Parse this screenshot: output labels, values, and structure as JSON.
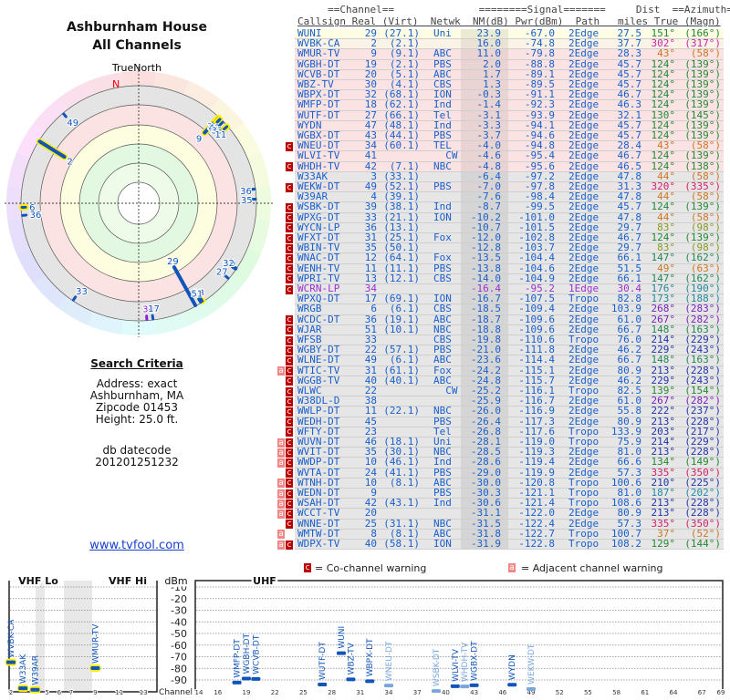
{
  "left": {
    "title1": "Ashburnham House",
    "title2": "All Channels",
    "north_label": "TrueNorth",
    "n_label": "N",
    "criteria_title": "Search Criteria",
    "address": "Address: exact",
    "city": "Ashburnham, MA",
    "zipcode": "Zipcode 01453",
    "height": "Height: 25.0 ft.",
    "db_label": "db datecode",
    "db_value": "201201251232",
    "link": "www.tvfool.com"
  },
  "table": {
    "header1": "     ==Channel==              ========Signal=======     Dist  ==Azimuth==",
    "header2": "Callsign Real (Virt)  Netwk  NM(dB) Pwr(dBm)  Path   miles True (Magn)",
    "tones": {
      "y1": "#fdfde4",
      "y2": "#fbf4e6",
      "p": "#fbe3e3",
      "p2": "#ece4e4",
      "g": "#e6e6e6"
    },
    "callsign_color": "#1a5fcc",
    "lp_color": "#9933cc",
    "rows": [
      [
        "WUNI",
        "29",
        "(27.1)",
        "Uni",
        "23.9",
        "-67.0",
        "2Edge",
        "27.5",
        "151°",
        "(166°)",
        "",
        "y1",
        "#228833"
      ],
      [
        "WVBK-CA",
        "2",
        "(2.1)",
        "",
        "16.0",
        "-74.8",
        "2Edge",
        "37.7",
        "302°",
        "(317°)",
        "",
        "y2",
        "#cc22aa"
      ],
      [
        "WMUR-TV",
        "9",
        "(9.1)",
        "ABC",
        "11.0",
        "-79.8",
        "2Edge",
        "28.3",
        "43°",
        "(58°)",
        "",
        "p",
        "#cc7722"
      ],
      [
        "WGBH-DT",
        "19",
        "(2.1)",
        "PBS",
        "2.0",
        "-88.8",
        "2Edge",
        "45.7",
        "124°",
        "(139°)",
        "",
        "p",
        "#228833"
      ],
      [
        "WCVB-DT",
        "20",
        "(5.1)",
        "ABC",
        "1.7",
        "-89.1",
        "2Edge",
        "45.7",
        "124°",
        "(139°)",
        "",
        "p",
        "#228833"
      ],
      [
        "WBZ-TV",
        "30",
        "(4.1)",
        "CBS",
        "1.3",
        "-89.5",
        "2Edge",
        "45.7",
        "124°",
        "(139°)",
        "",
        "p",
        "#228833"
      ],
      [
        "WBPX-DT",
        "32",
        "(68.1)",
        "ION",
        "-0.3",
        "-91.1",
        "2Edge",
        "46.7",
        "124°",
        "(139°)",
        "",
        "p",
        "#228833"
      ],
      [
        "WMFP-DT",
        "18",
        "(62.1)",
        "Ind",
        "-1.4",
        "-92.3",
        "2Edge",
        "46.3",
        "124°",
        "(139°)",
        "",
        "p",
        "#228833"
      ],
      [
        "WUTF-DT",
        "27",
        "(66.1)",
        "Tel",
        "-3.1",
        "-93.9",
        "2Edge",
        "32.1",
        "130°",
        "(145°)",
        "",
        "p",
        "#228833"
      ],
      [
        "WYDN",
        "47",
        "(48.1)",
        "Ind",
        "-3.3",
        "-94.1",
        "2Edge",
        "45.7",
        "124°",
        "(139°)",
        "",
        "p",
        "#228833"
      ],
      [
        "WGBX-DT",
        "43",
        "(44.1)",
        "PBS",
        "-3.7",
        "-94.6",
        "2Edge",
        "45.7",
        "124°",
        "(139°)",
        "",
        "p",
        "#228833"
      ],
      [
        "WNEU-DT",
        "34",
        "(60.1)",
        "TEL",
        "-4.0",
        "-94.8",
        "2Edge",
        "28.4",
        "43°",
        "(58°)",
        "c",
        "p",
        "#cc7722"
      ],
      [
        "WLVI-TV",
        "41",
        "",
        "CW",
        "-4.6",
        "-95.4",
        "2Edge",
        "46.7",
        "124°",
        "(139°)",
        "",
        "p",
        "#228833"
      ],
      [
        "WHDH-TV",
        "42",
        "(7.1)",
        "NBC",
        "-4.8",
        "-95.6",
        "2Edge",
        "46.5",
        "124°",
        "(138°)",
        "c",
        "p",
        "#228833"
      ],
      [
        "W33AK",
        "3",
        "(33.1)",
        "",
        "-6.4",
        "-97.2",
        "2Edge",
        "47.8",
        "44°",
        "(58°)",
        "",
        "g",
        "#cc7722"
      ],
      [
        "WEKW-DT",
        "49",
        "(52.1)",
        "PBS",
        "-7.0",
        "-97.8",
        "2Edge",
        "31.3",
        "320°",
        "(335°)",
        "c",
        "p2",
        "#cc2266"
      ],
      [
        "W39AR",
        "4",
        "(39.1)",
        "",
        "-7.6",
        "-98.4",
        "2Edge",
        "47.8",
        "44°",
        "(58°)",
        "",
        "g",
        "#cc7722"
      ],
      [
        "WSBK-DT",
        "39",
        "(38.1)",
        "Ind",
        "-8.7",
        "-99.5",
        "2Edge",
        "45.7",
        "124°",
        "(139°)",
        "c",
        "g",
        "#228833"
      ],
      [
        "WPXG-DT",
        "33",
        "(21.1)",
        "ION",
        "-10.2",
        "-101.0",
        "2Edge",
        "47.8",
        "44°",
        "(58°)",
        "c",
        "g",
        "#cc7722"
      ],
      [
        "WYCN-LP",
        "36",
        "(13.1)",
        "",
        "-10.7",
        "-101.5",
        "2Edge",
        "29.7",
        "83°",
        "(98°)",
        "c",
        "g",
        "#889922"
      ],
      [
        "WFXT-DT",
        "31",
        "(25.1)",
        "Fox",
        "-12.0",
        "-102.8",
        "2Edge",
        "46.7",
        "124°",
        "(139°)",
        "c",
        "g",
        "#228833"
      ],
      [
        "WBIN-TV",
        "35",
        "(50.1)",
        "",
        "-12.8",
        "-103.7",
        "2Edge",
        "29.7",
        "83°",
        "(98°)",
        "c",
        "g",
        "#889922"
      ],
      [
        "WNAC-DT",
        "12",
        "(64.1)",
        "Fox",
        "-13.5",
        "-104.4",
        "2Edge",
        "66.1",
        "147°",
        "(162°)",
        "c",
        "g",
        "#228855"
      ],
      [
        "WENH-TV",
        "11",
        "(11.1)",
        "PBS",
        "-13.8",
        "-104.6",
        "2Edge",
        "51.5",
        "49°",
        "(63°)",
        "c",
        "g",
        "#cc7722"
      ],
      [
        "WPRI-TV",
        "13",
        "(12.1)",
        "CBS",
        "-14.0",
        "-104.9",
        "2Edge",
        "66.1",
        "147°",
        "(162°)",
        "c",
        "g",
        "#228855"
      ],
      [
        "WCRN-LP",
        "34",
        "",
        "",
        "-16.4",
        "-95.2",
        "1Edge",
        "30.4",
        "176°",
        "(190°)",
        "c",
        "g",
        "#228899"
      ],
      [
        "WPXQ-DT",
        "17",
        "(69.1)",
        "ION",
        "-16.7",
        "-107.5",
        "Tropo",
        "82.8",
        "173°",
        "(188°)",
        "",
        "g",
        "#228899"
      ],
      [
        "WRGB",
        "6",
        "(6.1)",
        "CBS",
        "-18.5",
        "-109.4",
        "2Edge",
        "103.9",
        "268°",
        "(283°)",
        "",
        "g",
        "#7722bb"
      ],
      [
        "WCDC-DT",
        "36",
        "(19.1)",
        "ABC",
        "-18.7",
        "-109.6",
        "2Edge",
        "61.0",
        "267°",
        "(282°)",
        "c",
        "g",
        "#7722bb"
      ],
      [
        "WJAR",
        "51",
        "(10.1)",
        "NBC",
        "-18.8",
        "-109.6",
        "2Edge",
        "66.7",
        "148°",
        "(163°)",
        "c",
        "g",
        "#228855"
      ],
      [
        "WFSB",
        "33",
        "",
        "CBS",
        "-19.8",
        "-110.6",
        "Tropo",
        "76.0",
        "214°",
        "(229°)",
        "c",
        "g",
        "#2233aa"
      ],
      [
        "WGBY-DT",
        "22",
        "(57.1)",
        "PBS",
        "-21.0",
        "-111.8",
        "2Edge",
        "46.2",
        "229°",
        "(243°)",
        "c",
        "g",
        "#2233aa"
      ],
      [
        "WLNE-DT",
        "49",
        "(6.1)",
        "ABC",
        "-23.6",
        "-114.4",
        "2Edge",
        "66.7",
        "148°",
        "(163°)",
        "c",
        "g",
        "#228855"
      ],
      [
        "WTIC-TV",
        "31",
        "(61.1)",
        "Fox",
        "-24.2",
        "-115.1",
        "2Edge",
        "80.9",
        "213°",
        "(228°)",
        "ac",
        "g",
        "#2233aa"
      ],
      [
        "WGGB-TV",
        "40",
        "(40.1)",
        "ABC",
        "-24.8",
        "-115.7",
        "2Edge",
        "46.2",
        "229°",
        "(243°)",
        "c",
        "g",
        "#2233aa"
      ],
      [
        "WLWC",
        "22",
        "",
        "CW",
        "-25.2",
        "-116.1",
        "Tropo",
        "82.5",
        "139°",
        "(154°)",
        "c",
        "g",
        "#228833"
      ],
      [
        "W38DL-D",
        "38",
        "",
        "",
        "-25.9",
        "-116.7",
        "2Edge",
        "61.0",
        "267°",
        "(282°)",
        "c",
        "g",
        "#7722bb"
      ],
      [
        "WWLP-DT",
        "11",
        "(22.1)",
        "NBC",
        "-26.0",
        "-116.9",
        "2Edge",
        "55.8",
        "222°",
        "(237°)",
        "c",
        "g",
        "#2233aa"
      ],
      [
        "WEDH-DT",
        "45",
        "",
        "PBS",
        "-26.4",
        "-117.3",
        "2Edge",
        "80.9",
        "213°",
        "(228°)",
        "c",
        "g",
        "#2233aa"
      ],
      [
        "WFTY-DT",
        "23",
        "",
        "Tel",
        "-26.8",
        "-117.6",
        "Tropo",
        "133.9",
        "203°",
        "(217°)",
        "c",
        "g",
        "#2233aa"
      ],
      [
        "WUVN-DT",
        "46",
        "(18.1)",
        "Uni",
        "-28.1",
        "-119.0",
        "Tropo",
        "75.9",
        "214°",
        "(229°)",
        "ac",
        "g",
        "#2233aa"
      ],
      [
        "WVIT-DT",
        "35",
        "(30.1)",
        "NBC",
        "-28.5",
        "-119.3",
        "2Edge",
        "81.0",
        "213°",
        "(228°)",
        "ac",
        "g",
        "#2233aa"
      ],
      [
        "WWDP-DT",
        "10",
        "(46.1)",
        "Ind",
        "-28.6",
        "-119.4",
        "2Edge",
        "66.6",
        "134°",
        "(149°)",
        "ac",
        "g",
        "#228833"
      ],
      [
        "WVTA-DT",
        "24",
        "(41.1)",
        "PBS",
        "-29.0",
        "-119.9",
        "2Edge",
        "57.3",
        "335°",
        "(350°)",
        "c",
        "g",
        "#cc2266"
      ],
      [
        "WTNH-DT",
        "10",
        "(8.1)",
        "ABC",
        "-30.0",
        "-120.8",
        "Tropo",
        "100.6",
        "210°",
        "(225°)",
        "ac",
        "g",
        "#2233aa"
      ],
      [
        "WEDN-DT",
        "9",
        "",
        "PBS",
        "-30.3",
        "-121.1",
        "Tropo",
        "81.0",
        "187°",
        "(202°)",
        "ac",
        "g",
        "#2288aa"
      ],
      [
        "WSAH-DT",
        "42",
        "(43.1)",
        "Ind",
        "-30.6",
        "-121.4",
        "Tropo",
        "108.6",
        "213°",
        "(228°)",
        "ac",
        "g",
        "#2233aa"
      ],
      [
        "WCCT-TV",
        "20",
        "",
        "",
        "-31.1",
        "-122.0",
        "2Edge",
        "80.9",
        "213°",
        "(228°)",
        "ac",
        "g",
        "#2233aa"
      ],
      [
        "WNNE-DT",
        "25",
        "(31.1)",
        "NBC",
        "-31.5",
        "-122.4",
        "2Edge",
        "57.3",
        "335°",
        "(350°)",
        "c",
        "g",
        "#cc2266"
      ],
      [
        "WMTW-DT",
        "8",
        "(8.1)",
        "ABC",
        "-31.8",
        "-122.7",
        "Tropo",
        "100.7",
        "37°",
        "(52°)",
        "a",
        "g",
        "#cc7722"
      ],
      [
        "WDPX-TV",
        "40",
        "(58.1)",
        "ION",
        "-31.9",
        "-122.8",
        "Tropo",
        "108.2",
        "129°",
        "(144°)",
        "ac",
        "g",
        "#228833"
      ]
    ]
  },
  "polar": {
    "stations": [
      {
        "label": "29",
        "az": 151,
        "nm": 23.9
      },
      {
        "label": "2",
        "az": 302,
        "nm": 16.0,
        "hl": true
      },
      {
        "label": "9",
        "az": 43,
        "nm": 11.0,
        "hl": true
      },
      {
        "label": "19",
        "az": 124,
        "nm": 2.0
      },
      {
        "label": "20",
        "az": 124,
        "nm": 1.7
      },
      {
        "label": "30",
        "az": 124,
        "nm": 1.3
      },
      {
        "label": "32",
        "az": 124,
        "nm": -0.3
      },
      {
        "label": "27",
        "az": 130,
        "nm": -3.1
      },
      {
        "label": "34",
        "az": 43,
        "nm": -4.0,
        "hl": true
      },
      {
        "label": "3",
        "az": 44,
        "nm": -6.4,
        "hl": true
      },
      {
        "label": "49",
        "az": 320,
        "nm": -7.0
      },
      {
        "label": "43",
        "az": 44,
        "nm": -10.2
      },
      {
        "label": "33",
        "az": 46,
        "nm": -10.2
      },
      {
        "label": "36",
        "az": 83,
        "nm": -10.7
      },
      {
        "label": "35",
        "az": 88,
        "nm": -12.8
      },
      {
        "label": "12",
        "az": 147,
        "nm": -13.5
      },
      {
        "label": "11",
        "az": 49,
        "nm": -13.8,
        "hl": true
      },
      {
        "label": "13",
        "az": 147,
        "nm": -14.0,
        "hl": true
      },
      {
        "label": "34",
        "az": 176,
        "nm": -16.4,
        "lp": true
      },
      {
        "label": "17",
        "az": 173,
        "nm": -16.7
      },
      {
        "label": "6",
        "az": 268,
        "nm": -18.5,
        "hl": true
      },
      {
        "label": "36",
        "az": 264,
        "nm": -18.7
      },
      {
        "label": "51",
        "az": 148,
        "nm": -18.8
      },
      {
        "label": "33",
        "az": 214,
        "nm": -19.8
      }
    ]
  },
  "legend": {
    "co": "= Co-channel warning",
    "adj": "= Adjacent channel warning",
    "c": "c",
    "a": "a"
  },
  "spectrum": {
    "vhf_lo": "VHF Lo",
    "vhf_hi": "VHF Hi",
    "uhf": "UHF",
    "unit": "dBm",
    "channel_label": "Channel",
    "dbm_ticks": [
      "-10",
      "-20",
      "-30",
      "-40",
      "-50",
      "-60",
      "-70",
      "-80",
      "-90"
    ],
    "vhf_ticks": [
      "2",
      "5",
      "6",
      "7",
      "9",
      "11",
      "13"
    ],
    "uhf_ticks": [
      "14",
      "16",
      "19",
      "22",
      "25",
      "28",
      "31",
      "34",
      "37",
      "40",
      "43",
      "46",
      "49",
      "52",
      "55",
      "58",
      "61",
      "64",
      "67",
      "69"
    ],
    "stations": [
      {
        "call": "WVBK-CA",
        "ch": 2,
        "dbm": -74.8,
        "hl": true
      },
      {
        "call": "W33AK",
        "ch": 3,
        "dbm": -97.2,
        "hl": true
      },
      {
        "call": "W39AR",
        "ch": 4,
        "dbm": -98.4,
        "hl": true
      },
      {
        "call": "WMUR-TV",
        "ch": 9,
        "dbm": -79.8,
        "hl": true
      },
      {
        "call": "WMFP-DT",
        "ch": 18,
        "dbm": -92.3
      },
      {
        "call": "WGBH-DT",
        "ch": 19,
        "dbm": -88.8
      },
      {
        "call": "WCVB-DT",
        "ch": 20,
        "dbm": -89.1
      },
      {
        "call": "WUTF-DT",
        "ch": 27,
        "dbm": -93.9
      },
      {
        "call": "WUNI",
        "ch": 29,
        "dbm": -67.0
      },
      {
        "call": "WBZ-TV",
        "ch": 30,
        "dbm": -89.5
      },
      {
        "call": "WBPX-DT",
        "ch": 32,
        "dbm": -91.1
      },
      {
        "call": "WNEU-DT",
        "ch": 34,
        "dbm": -94.8,
        "faded": true
      },
      {
        "call": "WSBK-DT",
        "ch": 39,
        "dbm": -99.5,
        "faded": true
      },
      {
        "call": "WLVI-TV",
        "ch": 41,
        "dbm": -95.4
      },
      {
        "call": "WHDH-TV",
        "ch": 42,
        "dbm": -95.6,
        "faded": true
      },
      {
        "call": "WGBX-DT",
        "ch": 43,
        "dbm": -94.6
      },
      {
        "call": "WYDN",
        "ch": 47,
        "dbm": -94.1
      },
      {
        "call": "WEKW-DT",
        "ch": 49,
        "dbm": -97.8,
        "faded": true
      }
    ]
  }
}
